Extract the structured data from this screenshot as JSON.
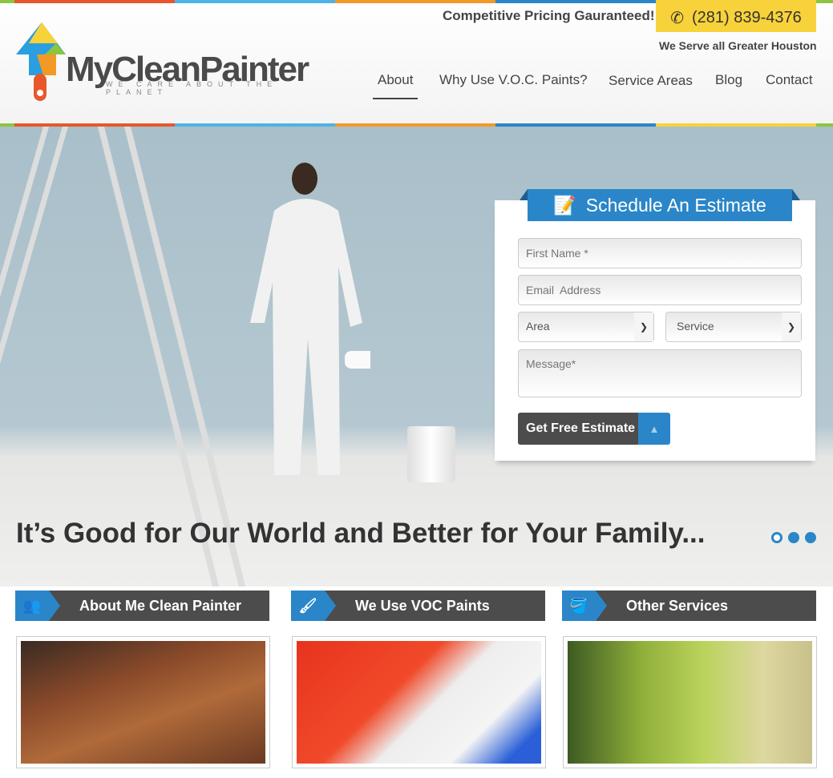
{
  "header": {
    "brand": "MyCleanPainter",
    "tagline": "WE CARE ABOUT THE PLANET",
    "promo": "Competitive Pricing Gauranteed!",
    "phone": "(281) 839-4376",
    "serve": "We Serve all Greater Houston",
    "nav": [
      {
        "label": "About",
        "active": true
      },
      {
        "label": "Why Use V.O.C. Paints?"
      },
      {
        "label": "Service Areas"
      },
      {
        "label": "Blog"
      },
      {
        "label": "Contact"
      }
    ]
  },
  "stripe_colors": [
    "#8cc63f",
    "#e8572a",
    "#4db3e6",
    "#f39a26",
    "#2a86c8",
    "#f8d23a",
    "#8cc63f"
  ],
  "hero": {
    "headline": "It’s Good for Our World and Better for Your Family...",
    "slides": 3,
    "active_slide": 1
  },
  "form": {
    "title": "Schedule An Estimate",
    "first_name_placeholder": "First Name *",
    "email_placeholder": "Email  Address",
    "area": "Area",
    "service": "Service",
    "message_placeholder": "Message*",
    "submit": "Get Free Estimate"
  },
  "sections": [
    {
      "title": "About Me Clean Painter",
      "icon": "users-icon"
    },
    {
      "title": "We Use VOC Paints",
      "icon": "paintbrush-icon"
    },
    {
      "title": "Other Services",
      "icon": "paint-bucket-icon"
    }
  ],
  "colors": {
    "accent": "#2a86c8",
    "dark": "#4c4c4c",
    "phone_bg": "#f8d23a"
  }
}
